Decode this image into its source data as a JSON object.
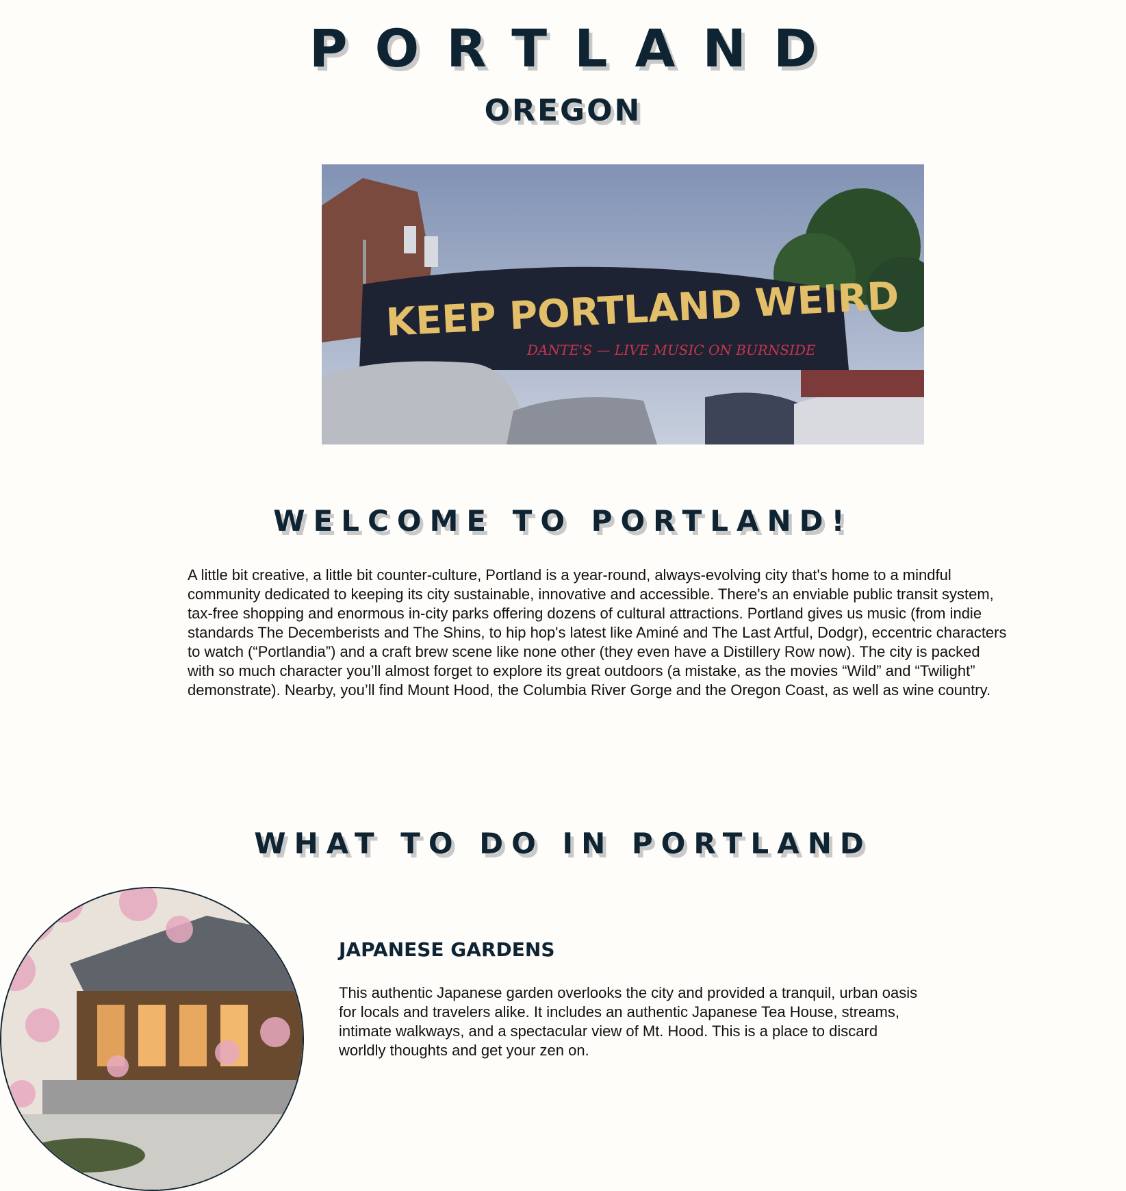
{
  "header": {
    "title": "PORTLAND",
    "subtitle": "OREGON"
  },
  "hero": {
    "sign_text": "KEEP PORTLAND WEIRD",
    "sub_sign_text": "DANTE'S — LIVE MUSIC ON BURNSIDE"
  },
  "welcome": {
    "heading": "WELCOME TO PORTLAND!",
    "text": "A little bit creative, a little bit counter-culture, Portland is a year-round, always-evolving city that's home to a mindful community dedicated to keeping its city sustainable, innovative and accessible. There's an enviable public transit system, tax-free shopping and enormous in-city parks offering dozens of cultural attractions. Portland gives us music (from indie standards The Decemberists and The Shins, to hip hop's latest like Aminé and The Last Artful, Dodgr), eccentric characters to watch (“Portlandia”) and a craft brew scene like none other (they even have a Distillery Row now). The city is packed with so much character you’ll almost forget to explore its great outdoors (a mistake, as the movies “Wild” and “Twilight” demonstrate). Nearby, you’ll find Mount Hood, the Columbia River Gorge and the Oregon Coast, as well as wine country."
  },
  "todo": {
    "heading": "WHAT TO DO IN PORTLAND",
    "items": [
      {
        "title": "JAPANESE GARDENS",
        "text": "This authentic Japanese garden overlooks the city and provided a tranquil, urban oasis for locals and travelers alike. It includes an authentic Japanese Tea House, streams, intimate walkways, and a spectacular view of Mt. Hood. This is a place to discard worldly thoughts and get your zen on."
      }
    ]
  },
  "colors": {
    "background": "#fefdfa",
    "heading": "#0f2433",
    "heading_shadow": "#c9c9c9"
  }
}
